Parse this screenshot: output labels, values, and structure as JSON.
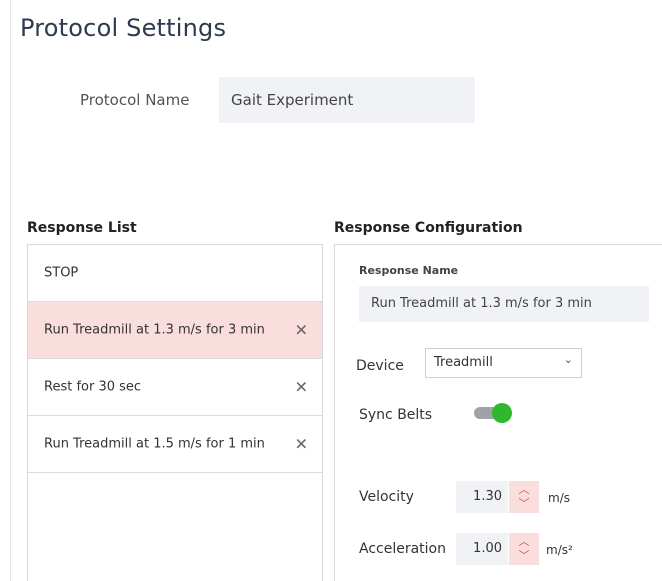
{
  "page": {
    "title": "Protocol Settings"
  },
  "protocol": {
    "name_label": "Protocol Name",
    "name_value": "Gait Experiment"
  },
  "response_list": {
    "title": "Response List",
    "items": [
      {
        "label": "STOP",
        "removable": false,
        "selected": false
      },
      {
        "label": "Run Treadmill at 1.3 m/s for 3 min",
        "removable": true,
        "selected": true
      },
      {
        "label": "Rest for 30 sec",
        "removable": true,
        "selected": false
      },
      {
        "label": "Run Treadmill at 1.5 m/s for 1 min",
        "removable": true,
        "selected": false
      }
    ],
    "remove_glyph": "✕"
  },
  "config": {
    "title": "Response Configuration",
    "response_name_label": "Response Name",
    "response_name_value": "Run Treadmill at 1.3 m/s for 3 min",
    "device_label": "Device",
    "device_value": "Treadmill",
    "sync_belts_label": "Sync Belts",
    "sync_belts_on": true,
    "velocity_label": "Velocity",
    "velocity_value": "1.30",
    "velocity_unit": "m/s",
    "acceleration_label": "Acceleration",
    "acceleration_value": "1.00",
    "acceleration_unit": "m/s²"
  },
  "colors": {
    "selected_bg": "#f9dedd",
    "toggle_on": "#2eb82e",
    "stepper_arrow": "#d9534f"
  }
}
